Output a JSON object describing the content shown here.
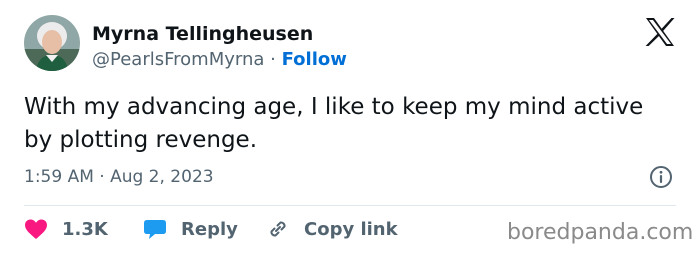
{
  "user": {
    "display_name": "Myrna Tellingheusen",
    "handle": "@PearlsFromMyrna",
    "separator": "·",
    "follow_label": "Follow",
    "avatar_icon": "profile-photo"
  },
  "platform_icon": "x-logo-icon",
  "tweet": {
    "text": "With my advancing age, I like to keep my mind active by plotting revenge.",
    "timestamp": "1:59 AM · Aug 2, 2023"
  },
  "actions": {
    "like_count": "1.3K",
    "reply_label": "Reply",
    "copy_link_label": "Copy link"
  },
  "watermark": "boredpanda.com",
  "colors": {
    "follow": "#006fd6",
    "like": "#f91880",
    "reply": "#1d9bf0",
    "muted": "#536471"
  }
}
